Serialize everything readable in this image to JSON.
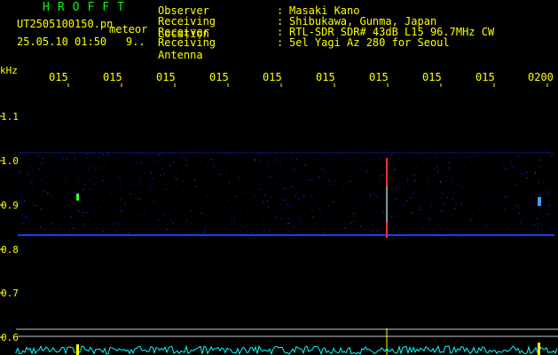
{
  "header": {
    "brand": "HROFFT",
    "filename": "UT2505100150.pn",
    "detection_label": "meteor",
    "datetime": "25.05.10 01:50",
    "count": "9.."
  },
  "station": [
    {
      "key": "Observer",
      "value": "Masaki Kano"
    },
    {
      "key": "Receiving Location",
      "value": "Shibukawa, Gunma, Japan"
    },
    {
      "key": "Receiver",
      "value": "RTL-SDR SDR# 43dB L15 96.7MHz CW"
    },
    {
      "key": "Receiving Antenna",
      "value": "5el Yagi Az 280 for Seoul"
    }
  ],
  "axis": {
    "unit": "kHz",
    "time_ticks": [
      "015",
      "015",
      "015",
      "015",
      "015",
      "015",
      "015",
      "015",
      "015",
      "0200"
    ],
    "freq_ticks": [
      "1.1",
      "1.0",
      "0.9",
      "0.8",
      "0.7",
      "0.6"
    ]
  },
  "colors": {
    "background": "#000000",
    "text": "#ffff00",
    "brand": "#00ff00",
    "signal": "#1e3cff",
    "noise": "#00ffff"
  }
}
